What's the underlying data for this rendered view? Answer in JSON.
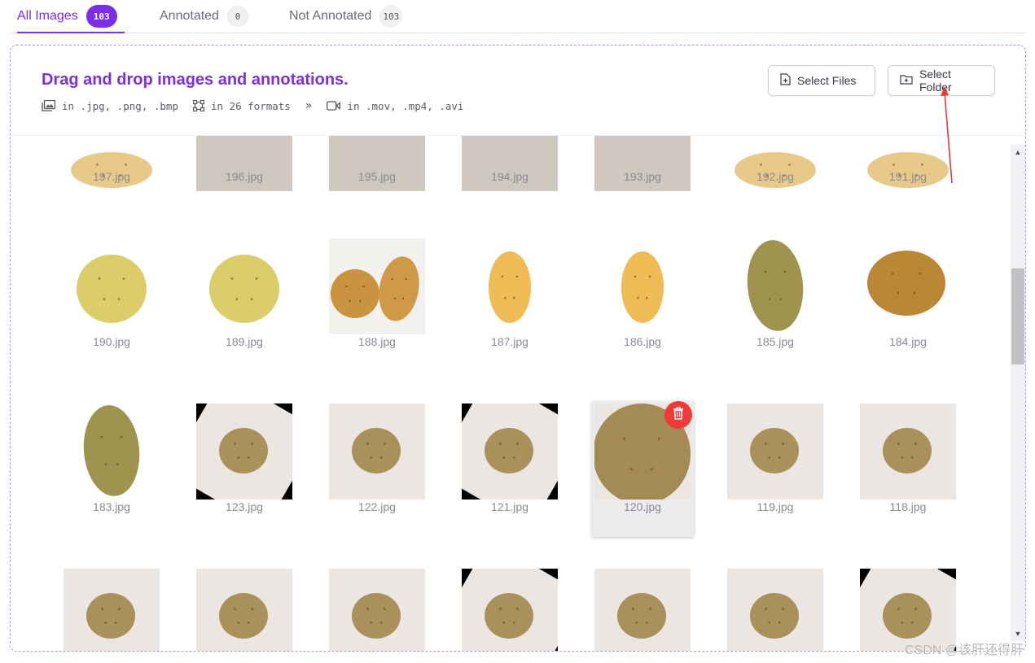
{
  "tabs": [
    {
      "label": "All Images",
      "count": "103",
      "active": true
    },
    {
      "label": "Annotated",
      "count": "0",
      "active": false
    },
    {
      "label": "Not Annotated",
      "count": "103",
      "active": false
    }
  ],
  "dropzone": {
    "title": "Drag and drop images and annotations.",
    "image_formats": "in .jpg, .png, .bmp",
    "annotation_formats": "in 26 formats",
    "separator": "»",
    "video_formats": "in .mov, .mp4, .avi",
    "select_files_label": "Select Files",
    "select_folder_label": "Select Folder"
  },
  "images": [
    {
      "name": "197.jpg",
      "style": "potato-top"
    },
    {
      "name": "196.jpg",
      "style": "bar"
    },
    {
      "name": "195.jpg",
      "style": "bar"
    },
    {
      "name": "194.jpg",
      "style": "bar"
    },
    {
      "name": "193.jpg",
      "style": "bar"
    },
    {
      "name": "192.jpg",
      "style": "potato-top"
    },
    {
      "name": "191.jpg",
      "style": "potato-top"
    },
    {
      "name": "190.jpg",
      "style": "yellow-round"
    },
    {
      "name": "189.jpg",
      "style": "yellow-round"
    },
    {
      "name": "188.jpg",
      "style": "two-potatoes"
    },
    {
      "name": "187.jpg",
      "style": "yellow-tall"
    },
    {
      "name": "186.jpg",
      "style": "yellow-tall"
    },
    {
      "name": "185.jpg",
      "style": "olive-tall"
    },
    {
      "name": "184.jpg",
      "style": "brown-round"
    },
    {
      "name": "183.jpg",
      "style": "olive-tall"
    },
    {
      "name": "123.jpg",
      "style": "paper-rotated"
    },
    {
      "name": "122.jpg",
      "style": "paper"
    },
    {
      "name": "121.jpg",
      "style": "paper-rotated"
    },
    {
      "name": "120.jpg",
      "style": "closeup"
    },
    {
      "name": "119.jpg",
      "style": "paper"
    },
    {
      "name": "118.jpg",
      "style": "paper"
    },
    {
      "name": "",
      "style": "paper"
    },
    {
      "name": "",
      "style": "paper"
    },
    {
      "name": "",
      "style": "paper"
    },
    {
      "name": "",
      "style": "paper-rotated"
    },
    {
      "name": "",
      "style": "paper"
    },
    {
      "name": "",
      "style": "paper"
    },
    {
      "name": "",
      "style": "paper-rotated"
    }
  ],
  "hovered_image": "120.jpg",
  "watermark": "CSDN @该肝还得肝",
  "colors": {
    "accent": "#7c2ee6",
    "delete": "#f03a3a"
  },
  "icons": {
    "image_format": "images-icon",
    "annotation_format": "bounding-box-icon",
    "video_format": "video-icon",
    "select_files": "file-plus-icon",
    "select_folder": "folder-plus-icon",
    "delete": "trash-icon"
  }
}
